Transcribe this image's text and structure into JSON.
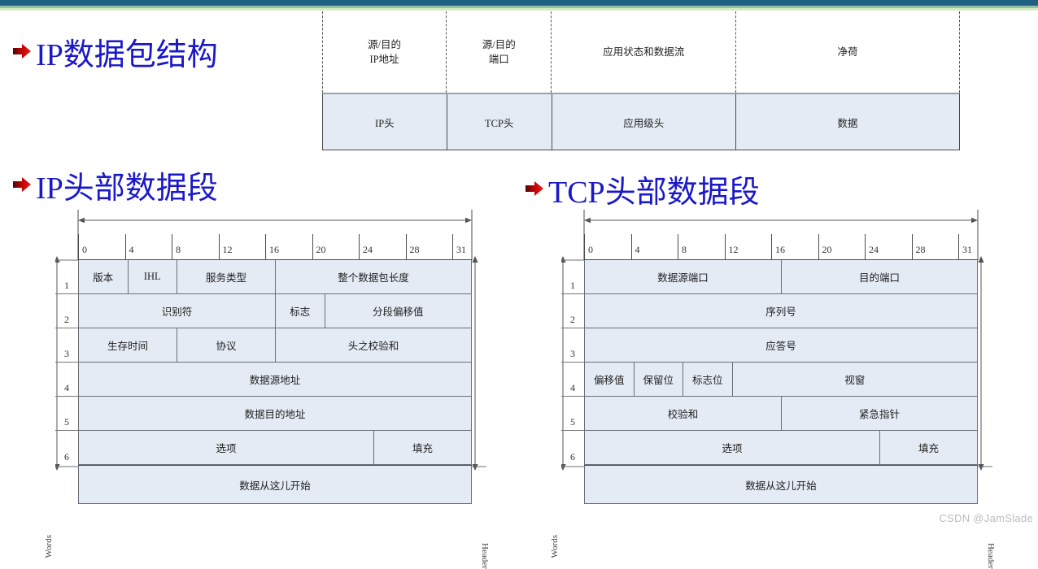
{
  "banner": {
    "stripe1": "#1f6080",
    "stripe2": "#8fc1a8",
    "stripe3": "#d9e8c0"
  },
  "theme": {
    "heading_color": "#1a18c8",
    "cell_fill": "#e4ebf5",
    "cell_border": "#6a7078",
    "bullet_color": "#b00000"
  },
  "headings": {
    "packet_structure": "IP数据包结构",
    "ip_header": "IP头部数据段",
    "tcp_header": "TCP头部数据段"
  },
  "packet_table": {
    "upper_row": [
      {
        "label": "源/目的\nIP地址",
        "line1": "源/目的",
        "line2": "IP地址",
        "width_pct": 19.4
      },
      {
        "label": "源/目的\n端口",
        "line1": "源/目的",
        "line2": "端口",
        "width_pct": 16.5
      },
      {
        "label": "应用状态和数据流",
        "line1": "应用状态和数据流",
        "line2": "",
        "width_pct": 28.9
      },
      {
        "label": "净荷",
        "line1": "净荷",
        "line2": "",
        "width_pct": 35.2
      }
    ],
    "lower_row": [
      {
        "label": "IP头",
        "width_pct": 19.4
      },
      {
        "label": "TCP头",
        "width_pct": 16.5
      },
      {
        "label": "应用级头",
        "width_pct": 28.9
      },
      {
        "label": "数据",
        "width_pct": 35.2
      }
    ]
  },
  "bit_ticks": [
    "0",
    "4",
    "8",
    "12",
    "16",
    "20",
    "24",
    "28"
  ],
  "bit_end_tick": "31",
  "axis_labels": {
    "words": "Words",
    "header": "Header"
  },
  "ip_header": {
    "row_numbers": [
      "1",
      "2",
      "3",
      "4",
      "5",
      "6"
    ],
    "rows": [
      {
        "num": "1",
        "fields": [
          {
            "label": "版本",
            "bits": 4
          },
          {
            "label": "IHL",
            "bits": 4
          },
          {
            "label": "服务类型",
            "bits": 8
          },
          {
            "label": "整个数据包长度",
            "bits": 16
          }
        ]
      },
      {
        "num": "2",
        "fields": [
          {
            "label": "识别符",
            "bits": 16
          },
          {
            "label": "标志",
            "bits": 4
          },
          {
            "label": "分段偏移值",
            "bits": 12
          }
        ]
      },
      {
        "num": "3",
        "fields": [
          {
            "label": "生存时间",
            "bits": 8
          },
          {
            "label": "协议",
            "bits": 8
          },
          {
            "label": "头之校验和",
            "bits": 16
          }
        ]
      },
      {
        "num": "4",
        "fields": [
          {
            "label": "数据源地址",
            "bits": 32
          }
        ]
      },
      {
        "num": "5",
        "fields": [
          {
            "label": "数据目的地址",
            "bits": 32
          }
        ]
      },
      {
        "num": "6",
        "fields": [
          {
            "label": "选项",
            "bits": 24
          },
          {
            "label": "填充",
            "bits": 8
          }
        ]
      }
    ],
    "data_row": "数据从这儿开始"
  },
  "tcp_header": {
    "row_numbers": [
      "1",
      "2",
      "3",
      "4",
      "5",
      "6"
    ],
    "rows": [
      {
        "num": "1",
        "fields": [
          {
            "label": "数据源端口",
            "bits": 16
          },
          {
            "label": "目的端口",
            "bits": 16
          }
        ]
      },
      {
        "num": "2",
        "fields": [
          {
            "label": "序列号",
            "bits": 32
          }
        ]
      },
      {
        "num": "3",
        "fields": [
          {
            "label": "应答号",
            "bits": 32
          }
        ]
      },
      {
        "num": "4",
        "fields": [
          {
            "label": "偏移值",
            "bits": 4
          },
          {
            "label": "保留位",
            "bits": 4
          },
          {
            "label": "标志位",
            "bits": 4
          },
          {
            "label": "视窗",
            "bits": 20
          }
        ]
      },
      {
        "num": "5",
        "fields": [
          {
            "label": "校验和",
            "bits": 16
          },
          {
            "label": "紧急指针",
            "bits": 16
          }
        ]
      },
      {
        "num": "6",
        "fields": [
          {
            "label": "选项",
            "bits": 24
          },
          {
            "label": "填充",
            "bits": 8
          }
        ]
      }
    ],
    "data_row": "数据从这儿开始"
  },
  "watermark": "CSDN @JamSlade"
}
